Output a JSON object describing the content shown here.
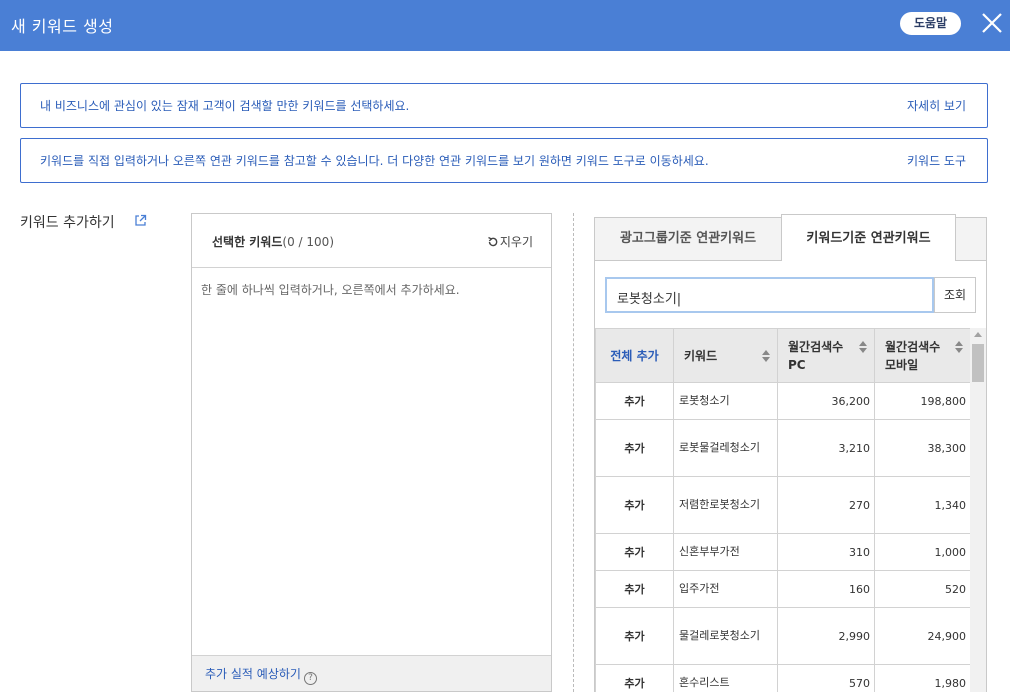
{
  "header": {
    "title": "새 키워드 생성",
    "help_label": "도움말"
  },
  "info": [
    {
      "message": "내 비즈니스에 관심이 있는 잠재 고객이 검색할 만한 키워드를 선택하세요.",
      "link": "자세히 보기"
    },
    {
      "message": "키워드를 직접 입력하거나 오른쪽 연관 키워드를 참고할 수 있습니다. 더 다양한 연관 키워드를 보기 원하면 키워드 도구로 이동하세요.",
      "link": "키워드 도구"
    }
  ],
  "add_section": {
    "label": "키워드 추가하기"
  },
  "selected": {
    "title": "선택한 키워드",
    "count": "(0 / 100)",
    "clear_label": "지우기",
    "placeholder": "한 줄에 하나씩 입력하거나, 오른쪽에서 추가하세요.",
    "forecast_label": "추가 실적 예상하기",
    "help_mark": "?"
  },
  "related": {
    "tabs": [
      "광고그룹기준 연관키워드",
      "키워드기준 연관키워드"
    ],
    "active_tab": 1,
    "search_value": "로봇청소기|",
    "search_button": "조회",
    "columns": {
      "add_all": "전체 추가",
      "keyword": "키워드",
      "pc_line1": "월간검색수",
      "pc_line2": "PC",
      "mobile_line1": "월간검색수",
      "mobile_line2": "모바일"
    },
    "add_label": "추가",
    "rows": [
      {
        "keyword": "로봇청소기",
        "pc": "36,200",
        "mobile": "198,800"
      },
      {
        "keyword": "로봇물걸레청소기",
        "pc": "3,210",
        "mobile": "38,300"
      },
      {
        "keyword": "저렴한로봇청소기",
        "pc": "270",
        "mobile": "1,340"
      },
      {
        "keyword": "신혼부부가전",
        "pc": "310",
        "mobile": "1,000"
      },
      {
        "keyword": "입주가전",
        "pc": "160",
        "mobile": "520"
      },
      {
        "keyword": "물걸레로봇청소기",
        "pc": "2,990",
        "mobile": "24,900"
      },
      {
        "keyword": "혼수리스트",
        "pc": "570",
        "mobile": "1,980"
      }
    ]
  },
  "colors": {
    "header": "#4a7fd5",
    "link": "#2a5cb8",
    "border_accent": "#3e6ecf"
  }
}
